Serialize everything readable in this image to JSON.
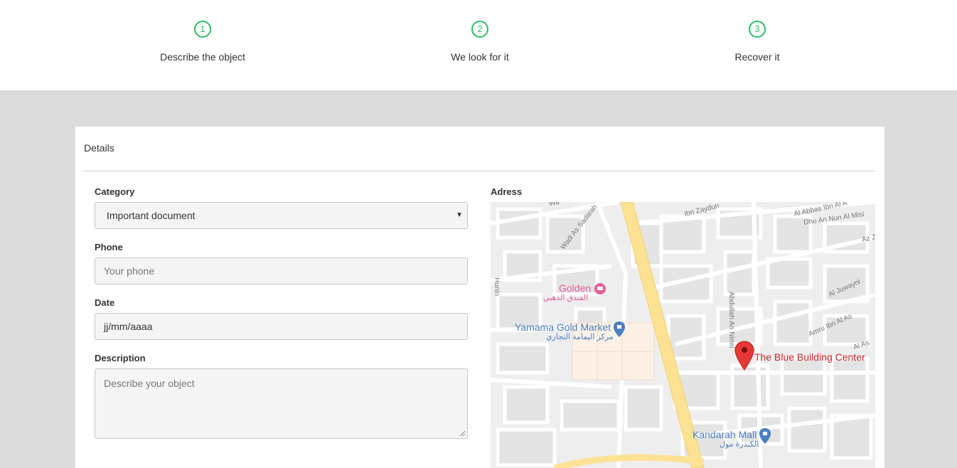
{
  "steps": [
    {
      "number": "1",
      "label": "Describe the object"
    },
    {
      "number": "2",
      "label": "We look for it"
    },
    {
      "number": "3",
      "label": "Recover it"
    }
  ],
  "details": {
    "title": "Details",
    "category": {
      "label": "Category",
      "value": "Important document"
    },
    "phone": {
      "label": "Phone",
      "placeholder": "Your phone"
    },
    "date": {
      "label": "Date",
      "value": "jj/mm/aaaa"
    },
    "description": {
      "label": "Description",
      "placeholder": "Describe your object"
    },
    "address": {
      "label": "Adress"
    }
  },
  "map": {
    "pois": {
      "golden_en": "Golden",
      "golden_ar": "الفندق الذهبي",
      "yamama_en": "Yamama Gold Market",
      "yamama_ar": "مركز اليمامة التجاري",
      "marker": "The Blue Building Center",
      "kandarah_en": "Kandarah Mall",
      "kandarah_ar": "الكندرة مول"
    },
    "streets": {
      "ibn_zaydun": "Ibn Zaydun",
      "abbas": "Al Abbas Ibn Al A",
      "dhu_an_nun": "Dhu An Nun Al Misi",
      "az": "Az Z",
      "wadi": "Wadi As Sadarah",
      "abdullah": "Abdullah An Nimri",
      "juwayni": "Al Juwayni",
      "amru": "Amru Ibn Al As",
      "al_as": "Al As",
      "hunin": "Hunin",
      "wa": "Wa"
    },
    "colors": {
      "road": "#ffffff",
      "block": "#e5e5e5",
      "highway": "#fde293",
      "poi_blue": "#4a7fc1",
      "poi_pink": "#e0609a",
      "marker": "#e53935",
      "marker_text": "#c62828"
    }
  },
  "colors": {
    "step_accent": "#2ebd68",
    "page_background": "#dcdcdc"
  }
}
